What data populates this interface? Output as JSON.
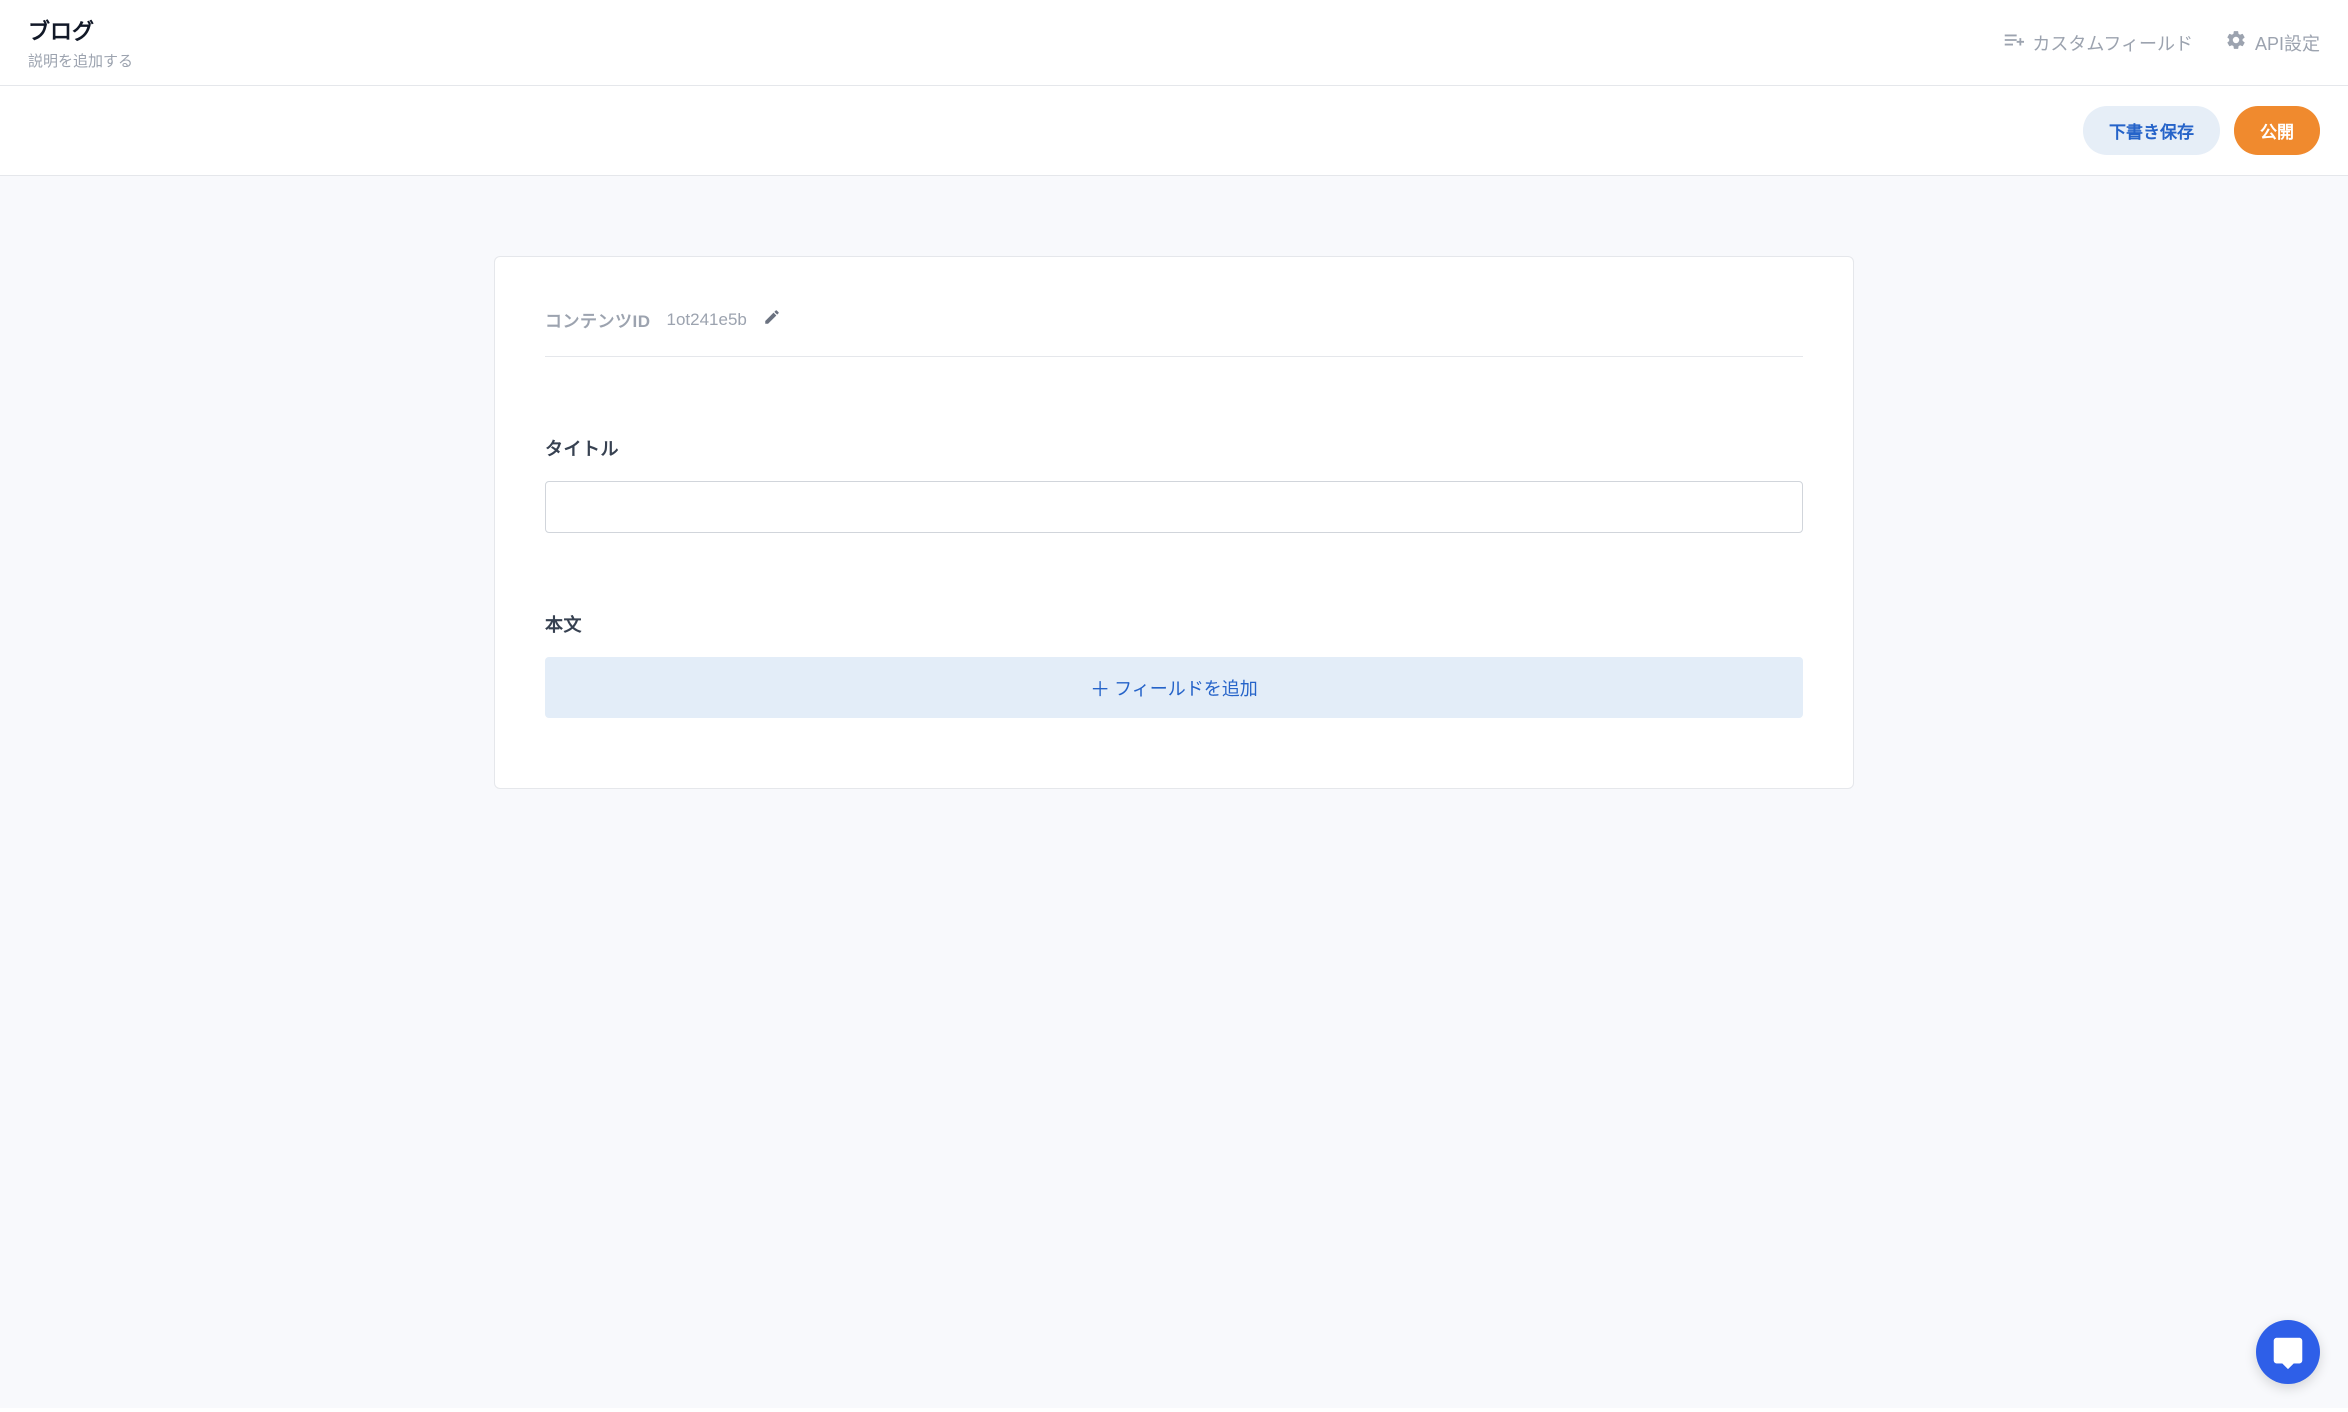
{
  "header": {
    "title": "ブログ",
    "subtitle": "説明を追加する",
    "actions": {
      "custom_field": "カスタムフィールド",
      "api_settings": "API設定"
    }
  },
  "action_bar": {
    "draft_label": "下書き保存",
    "publish_label": "公開"
  },
  "content": {
    "id_label": "コンテンツID",
    "id_value": "1ot241e5b",
    "fields": {
      "title": {
        "label": "タイトル",
        "value": ""
      },
      "body": {
        "label": "本文",
        "add_field_label": "フィールドを追加"
      }
    }
  }
}
